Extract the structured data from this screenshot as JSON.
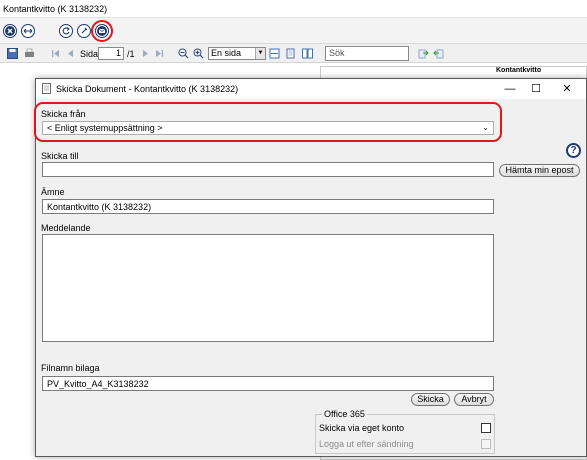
{
  "window": {
    "title": "Kontantkvitto (K  3138232)"
  },
  "viewer": {
    "page_label": "Sida",
    "page_value": "1",
    "page_total": "/1",
    "zoom_value": "En sida",
    "search_placeholder": "Sök",
    "report_heading": "Kontantkvitto"
  },
  "dialog": {
    "title": "Skicka Dokument - Kontantkvitto (K  3138232)",
    "minimize": "—",
    "maximize": "☐",
    "close": "✕",
    "send_from_label": "Skicka från",
    "send_from_value": "< Enligt systemuppsättning >",
    "send_to_label": "Skicka till",
    "send_to_value": "",
    "fetch_email_label": "Hämta min epost",
    "help_label": "?",
    "subject_label": "Ämne",
    "subject_value": "Kontantkvitto (K  3138232)",
    "message_label": "Meddelande",
    "message_value": "",
    "filename_label": "Filnamn bilaga",
    "filename_value": "PV_Kvitto_A4_K3138232",
    "send_button": "Skicka",
    "cancel_button": "Avbryt",
    "office_group_label": "Office 365",
    "own_account_label": "Skicka via eget konto",
    "logout_label": "Logga ut efter sändning"
  },
  "colors": {
    "highlight": "#e01818",
    "icon_navy": "#1e3a6e"
  }
}
